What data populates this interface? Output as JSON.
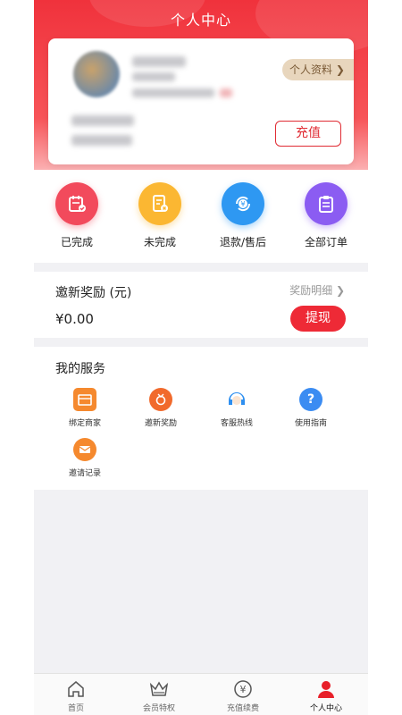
{
  "header": {
    "title": "个人中心"
  },
  "profile": {
    "link_label": "个人资料",
    "recharge_label": "充值"
  },
  "orders": [
    {
      "label": "已完成",
      "icon": "calendar-check-icon",
      "color": "#f24a5c"
    },
    {
      "label": "未完成",
      "icon": "document-x-icon",
      "color": "#fbb732"
    },
    {
      "label": "退款/售后",
      "icon": "refund-yen-icon",
      "color": "#2e98f2"
    },
    {
      "label": "全部订单",
      "icon": "clipboard-icon",
      "color": "#8b5cf2"
    }
  ],
  "reward": {
    "title": "邀新奖励 (元)",
    "detail_label": "奖励明细",
    "amount": "¥0.00",
    "withdraw_label": "提现"
  },
  "services": {
    "title": "我的服务",
    "items": [
      {
        "label": "绑定商家",
        "icon": "store-icon",
        "color": "#f5892e"
      },
      {
        "label": "邀新奖励",
        "icon": "medal-icon",
        "color": "#f16a2c"
      },
      {
        "label": "客服热线",
        "icon": "customer-service-icon",
        "color": "#2e8ff0"
      },
      {
        "label": "使用指南",
        "icon": "help-icon",
        "color": "#3b8cf2"
      },
      {
        "label": "邀请记录",
        "icon": "envelope-icon",
        "color": "#f5892e"
      }
    ]
  },
  "tabbar": {
    "items": [
      {
        "label": "首页",
        "icon": "home-icon"
      },
      {
        "label": "会员特权",
        "icon": "crown-icon"
      },
      {
        "label": "充值续费",
        "icon": "yen-icon"
      },
      {
        "label": "个人中心",
        "icon": "person-icon",
        "active": true
      }
    ]
  }
}
